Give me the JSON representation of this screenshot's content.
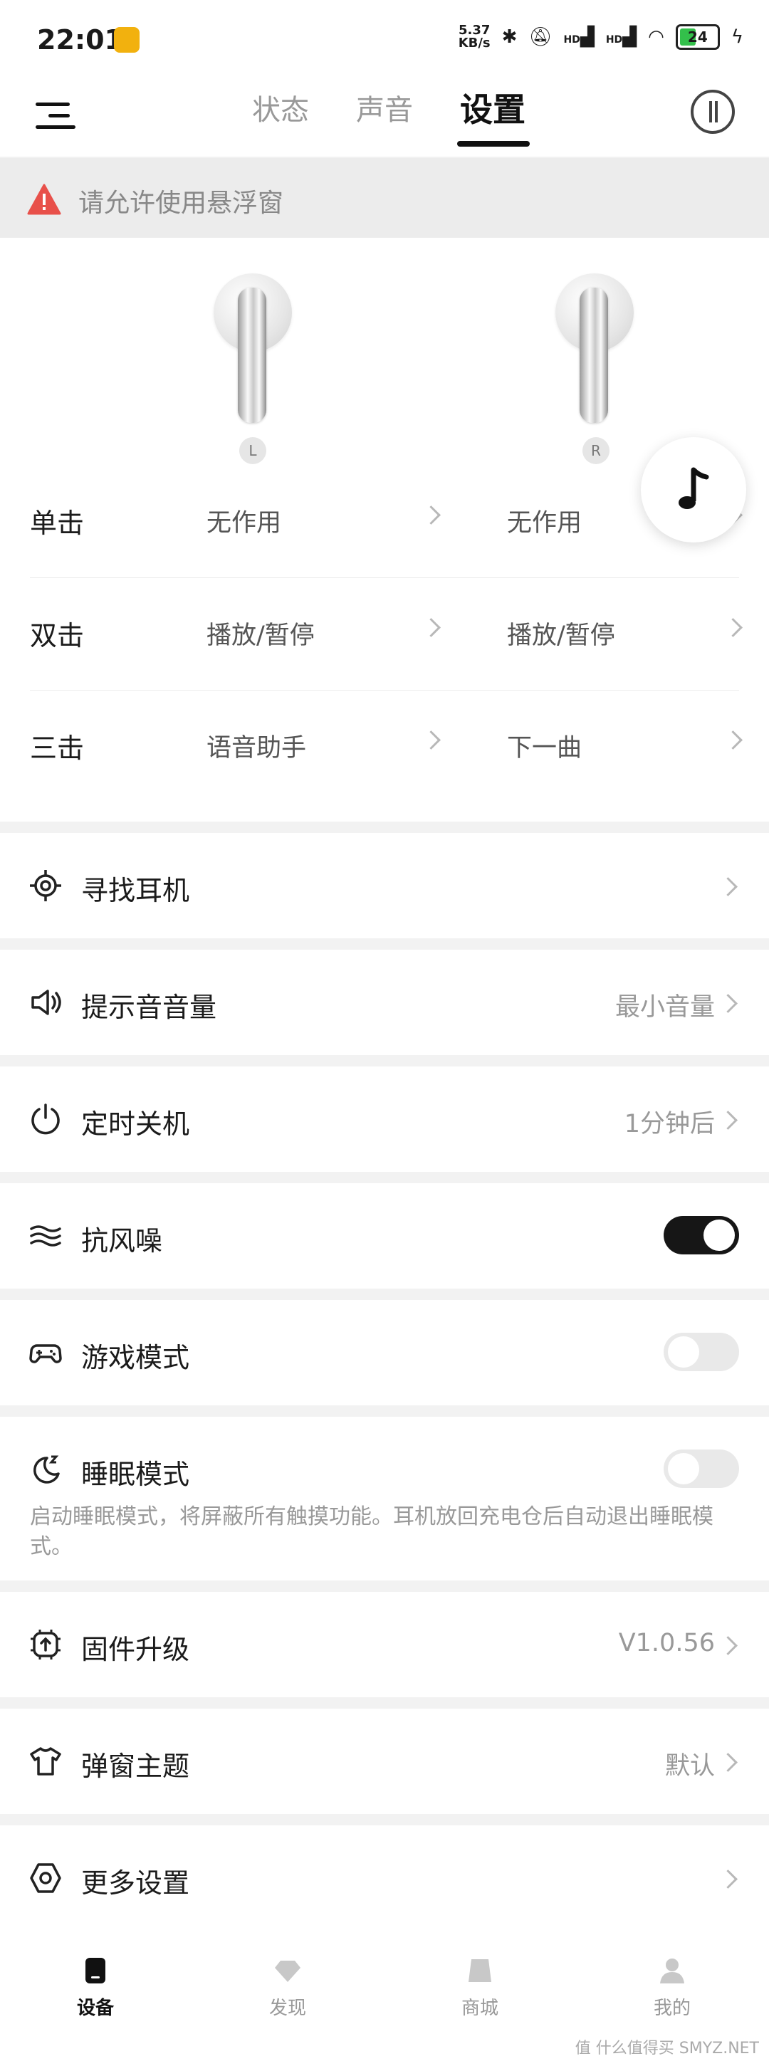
{
  "status": {
    "time": "22:01",
    "net_speed_top": "5.37",
    "net_speed_bottom": "KB/s",
    "hd1": "HD",
    "hd2": "HD",
    "battery": "24"
  },
  "top_nav": {
    "tabs": [
      "状态",
      "声音",
      "设置"
    ],
    "active_tab": "设置"
  },
  "warning": {
    "text": "请允许使用悬浮窗"
  },
  "earbuds": {
    "left_label": "L",
    "right_label": "R"
  },
  "gestures": [
    {
      "label": "单击",
      "left": "无作用",
      "right": "无作用"
    },
    {
      "label": "双击",
      "left": "播放/暂停",
      "right": "播放/暂停"
    },
    {
      "label": "三击",
      "left": "语音助手",
      "right": "下一曲"
    }
  ],
  "settings": {
    "find_earbuds": {
      "title": "寻找耳机"
    },
    "prompt_volume": {
      "title": "提示音音量",
      "value": "最小音量"
    },
    "auto_off": {
      "title": "定时关机",
      "value": "1分钟后"
    },
    "wind_noise": {
      "title": "抗风噪",
      "enabled": true
    },
    "game_mode": {
      "title": "游戏模式",
      "enabled": false
    },
    "sleep_mode": {
      "title": "睡眠模式",
      "enabled": false,
      "description": "启动睡眠模式，将屏蔽所有触摸功能。耳机放回充电仓后自动退出睡眠模式。"
    },
    "firmware": {
      "title": "固件升级",
      "value": "V1.0.56"
    },
    "popup_theme": {
      "title": "弹窗主题",
      "value": "默认"
    },
    "more_settings": {
      "title": "更多设置"
    }
  },
  "bottom_nav": {
    "items": [
      "设备",
      "发现",
      "商城",
      "我的"
    ],
    "active": "设备"
  },
  "watermark": "值 什么值得买 SMYZ.NET"
}
